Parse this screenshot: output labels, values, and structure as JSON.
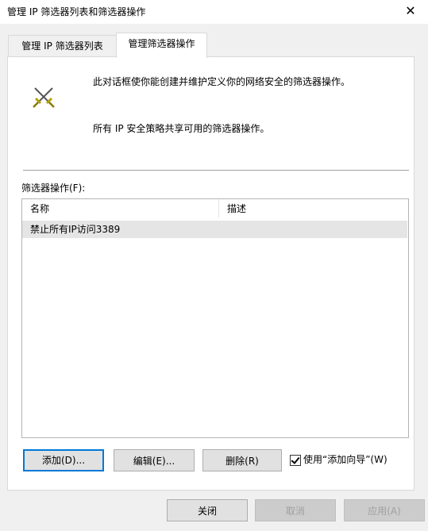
{
  "window": {
    "title": "管理 IP 筛选器列表和筛选器操作",
    "close_glyph": "✕"
  },
  "tabs": [
    {
      "label": "管理 IP 筛选器列表",
      "active": false
    },
    {
      "label": "管理筛选器操作",
      "active": true
    }
  ],
  "panel": {
    "icon": "crossed-swords-icon",
    "description_1": "此对话框使你能创建并维护定义你的网络安全的筛选器操作。",
    "description_2": "所有 IP 安全策略共享可用的筛选器操作。",
    "list_label": "筛选器操作(F):",
    "columns": [
      "名称",
      "描述"
    ],
    "rows": [
      {
        "name": "禁止所有IP访问3389",
        "desc": ""
      }
    ],
    "buttons": {
      "add": "添加(D)...",
      "edit": "编辑(E)...",
      "delete": "删除(R)"
    },
    "wizard_checkbox": {
      "label": "使用“添加向导”(W)",
      "checked": true
    }
  },
  "footer_buttons": {
    "close": "关闭",
    "cancel": "取消",
    "apply": "应用(A)"
  }
}
